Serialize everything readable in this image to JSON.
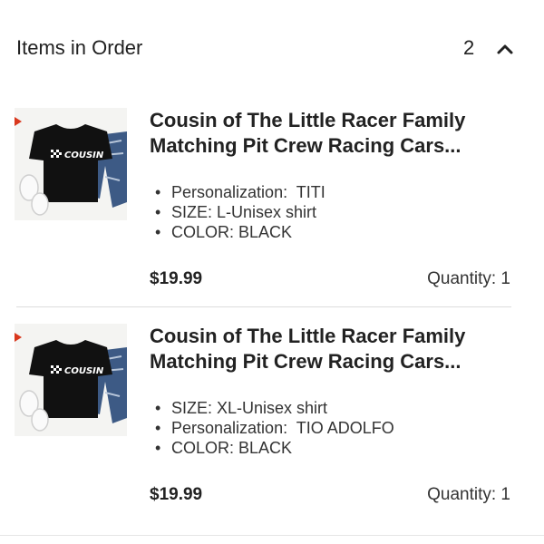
{
  "header": {
    "title": "Items in Order",
    "count": "2",
    "toggle_icon": "chevron-up-icon"
  },
  "items": [
    {
      "title": "Cousin of The Little Racer Family Matching Pit Crew Racing Cars...",
      "image_text": "COUSIN",
      "attributes": [
        "Personalization:  TITI",
        "SIZE: L-Unisex shirt",
        "COLOR: BLACK"
      ],
      "price": "$19.99",
      "quantity": "Quantity: 1"
    },
    {
      "title": "Cousin of The Little Racer Family Matching Pit Crew Racing Cars...",
      "image_text": "COUSIN",
      "attributes": [
        "SIZE: XL-Unisex shirt",
        "Personalization:  TIO ADOLFO",
        "COLOR: BLACK"
      ],
      "price": "$19.99",
      "quantity": "Quantity: 1"
    }
  ],
  "colors": {
    "text": "#222222",
    "divider": "#dddddd",
    "shirt": "#111111",
    "jeans": "#3d5a85"
  }
}
